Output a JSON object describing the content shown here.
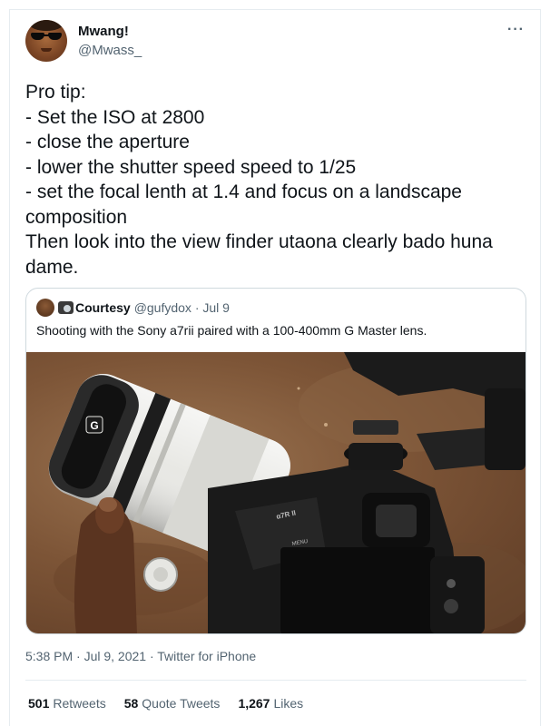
{
  "author": {
    "display_name": "Mwang!",
    "handle": "@Mwass_",
    "avatar_icon": "avatar-sunglasses"
  },
  "more_icon": "more-options-icon",
  "tweet_text": "Pro tip:\n- Set the ISO at 2800\n- close the aperture\n- lower the shutter speed speed to 1/25\n- set the focal lenth at 1.4 and focus on a landscape composition\nThen look into the view finder utaona clearly bado huna dame.",
  "quoted": {
    "avatar_icon": "avatar",
    "prefix_icon": "camera-emoji-icon",
    "name": "Courtesy",
    "handle_date": "@gufydox · Jul 9",
    "text": "Shooting with the Sony a7rii paired with a 100-400mm G Master lens.",
    "photo": {
      "lens_badge": "G",
      "body_label": "α7R II",
      "menu_label": "MENU"
    }
  },
  "meta": {
    "timestamp": "5:38 PM · Jul 9, 2021 · Twitter for iPhone"
  },
  "stats": [
    {
      "count": "501",
      "label": "Retweets"
    },
    {
      "count": "58",
      "label": "Quote Tweets"
    },
    {
      "count": "1,267",
      "label": "Likes"
    }
  ],
  "colors": {
    "text": "#0f1419",
    "secondary": "#536471",
    "border": "#cfd9de"
  }
}
